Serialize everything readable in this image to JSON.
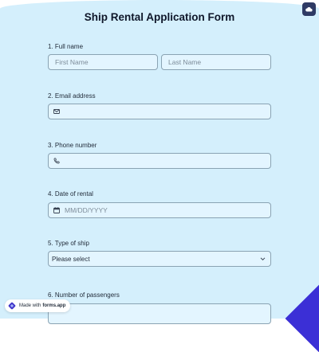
{
  "form": {
    "title": "Ship Rental Application Form",
    "questions": [
      {
        "label": "1.  Full name",
        "first_placeholder": "First Name",
        "last_placeholder": "Last Name"
      },
      {
        "label": "2. Email address",
        "icon": "envelope-icon"
      },
      {
        "label": "3. Phone number",
        "icon": "phone-icon"
      },
      {
        "label": "4. Date of rental",
        "icon": "calendar-icon",
        "placeholder": "MM/DD/YYYY"
      },
      {
        "label": "5. Type of ship",
        "select_value": "Please select"
      },
      {
        "label": "6. Number of passengers"
      }
    ]
  },
  "badge": {
    "prefix": "Made with",
    "brand": "forms.app"
  },
  "colors": {
    "background": "#d4effc",
    "field": "#e3f5ff",
    "accent": "#3b2fd6",
    "top_button": "#2e3a64"
  }
}
